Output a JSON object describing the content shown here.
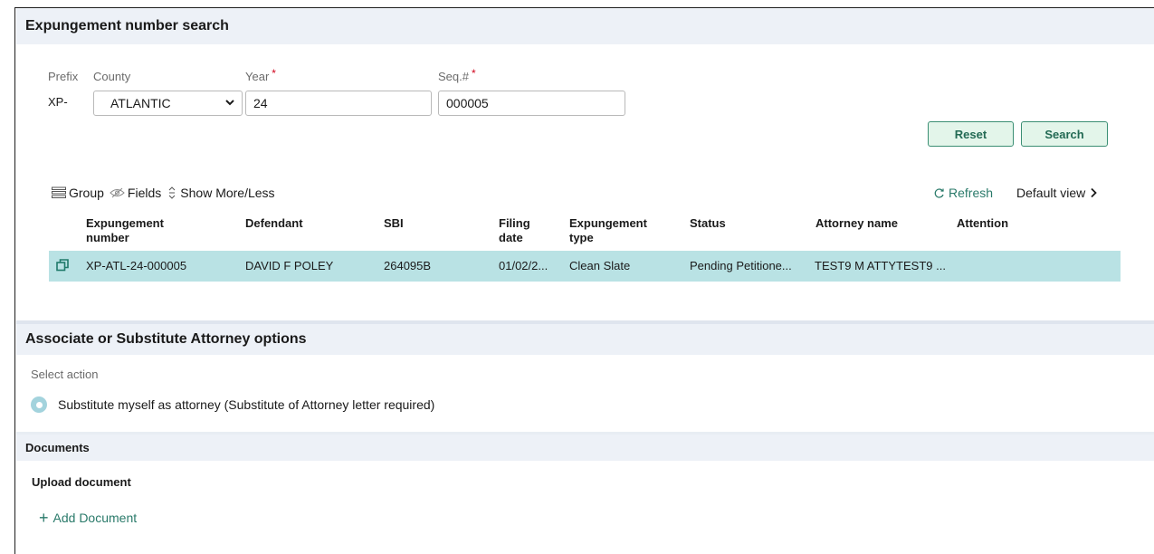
{
  "search_section": {
    "title": "Expungement number search",
    "prefix_label": "Prefix",
    "prefix_value": "XP-",
    "county_label": "County",
    "county_value": "ATLANTIC",
    "year_label": "Year",
    "year_value": "24",
    "seq_label": "Seq.#",
    "seq_value": "000005",
    "required_mark": "*",
    "reset_label": "Reset",
    "search_label": "Search"
  },
  "toolbar": {
    "group_label": "Group",
    "fields_label": "Fields",
    "show_more_label": "Show More/Less",
    "refresh_label": "Refresh",
    "default_view_label": "Default view"
  },
  "table": {
    "headers": {
      "expungement_number": "Expungement number",
      "defendant": "Defendant",
      "sbi": "SBI",
      "filing_date": "Filing date",
      "expungement_type": "Expungement type",
      "status": "Status",
      "attorney_name": "Attorney name",
      "attention": "Attention"
    },
    "rows": [
      {
        "expungement_number": "XP-ATL-24-000005",
        "defendant": "DAVID F POLEY",
        "sbi": "264095B",
        "filing_date": "01/02/2...",
        "expungement_type": "Clean Slate",
        "status": "Pending Petitione...",
        "attorney_name": "TEST9 M ATTYTEST9 ...",
        "attention": ""
      }
    ]
  },
  "attorney_section": {
    "title": "Associate or Substitute Attorney options",
    "select_action_label": "Select action",
    "option_label": "Substitute myself as attorney (Substitute of Attorney letter required)"
  },
  "documents_section": {
    "title": "Documents",
    "upload_title": "Upload document",
    "add_document_label": "Add Document"
  },
  "colors": {
    "accent": "#2a7a6a",
    "button_bg": "#e3f5ea",
    "row_highlight": "#b9e2e4",
    "section_bar": "#edf1f7",
    "required": "#d0021b"
  },
  "icons": [
    "group-icon",
    "fields-eye-off-icon",
    "show-more-less-icon",
    "refresh-icon",
    "chevron-right-icon",
    "open-record-icon",
    "plus-icon"
  ]
}
